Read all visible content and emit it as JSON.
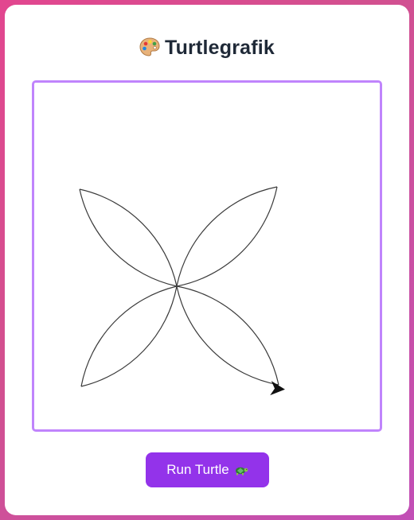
{
  "app": {
    "title": "Turtlegrafik",
    "title_icon": "palette-icon"
  },
  "canvas": {
    "description_shapes": "four-petal-flower",
    "stroke_color": "#333333",
    "border_color": "#c084fc"
  },
  "controls": {
    "run_label": "Run Turtle",
    "run_icon": "turtle-icon",
    "accent_color": "#9333ea"
  }
}
